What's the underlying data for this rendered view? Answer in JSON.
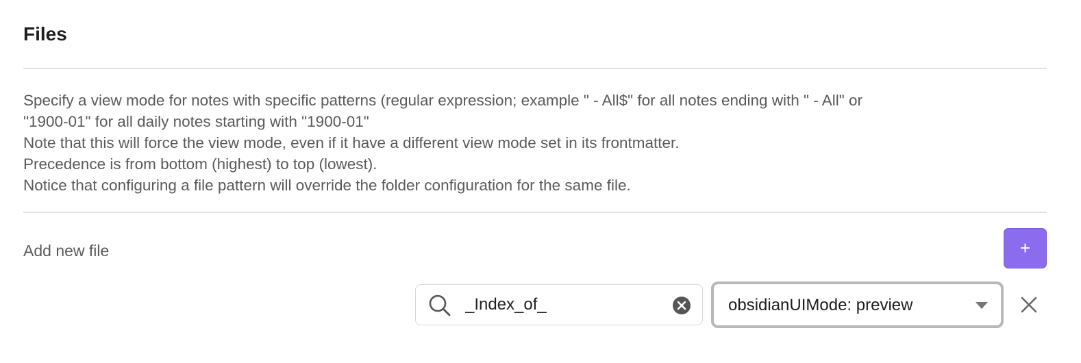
{
  "section": {
    "title": "Files"
  },
  "description": {
    "lines": [
      "Specify a view mode for notes with specific patterns (regular expression; example \" - All$\" for all notes ending with \" - All\" or",
      "\"1900-01\" for all daily notes starting with \"1900-01\"",
      "Note that this will force the view mode, even if it have a different view mode set in its frontmatter.",
      "Precedence is from bottom (highest) to top (lowest).",
      "Notice that configuring a file pattern will override the folder configuration for the same file."
    ]
  },
  "add_file": {
    "label": "Add new file",
    "button_label": "+"
  },
  "file_entry": {
    "pattern_value": "_Index_of_",
    "search_icon": "search-icon",
    "clear_icon": "clear-circle-icon",
    "mode_selected": "obsidianUIMode: preview",
    "dropdown_icon": "chevron-down-icon",
    "remove_icon": "close-icon"
  },
  "colors": {
    "accent": "#8b6cef",
    "text_muted": "#5a5a5a",
    "divider": "#e0e0e0"
  }
}
